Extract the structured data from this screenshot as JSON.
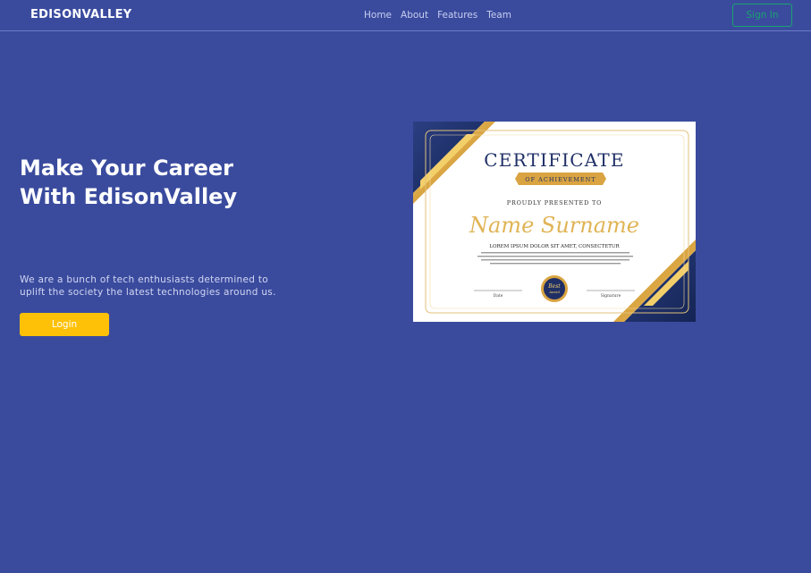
{
  "navbar": {
    "brand": "EDISONVALLEY",
    "links": [
      "Home",
      "About",
      "Features",
      "Team"
    ],
    "signin_label": "Sign In"
  },
  "hero": {
    "title_line1": "Make Your Career",
    "title_line2": "With EdisonValley",
    "description": "We are a bunch of tech enthusiasts determined to uplift the society the latest technologies around us.",
    "login_label": "Login"
  },
  "certificate": {
    "heading": "CERTIFICATE",
    "ribbon": "OF ACHIEVEMENT",
    "presented": "PROUDLY PRESENTED TO",
    "name": "Name Surname",
    "subtitle": "LOREM IPSUM DOLOR SIT AMET, CONSECTETUR",
    "date_label": "Date",
    "signature_label": "Signature",
    "badge_line1": "Best",
    "badge_line2": "Award"
  },
  "colors": {
    "background": "#3a4b9e",
    "accent_yellow": "#ffc107",
    "signin_green": "#1aa36f",
    "navy": "#1f2f66",
    "gold": "#d9a441"
  }
}
